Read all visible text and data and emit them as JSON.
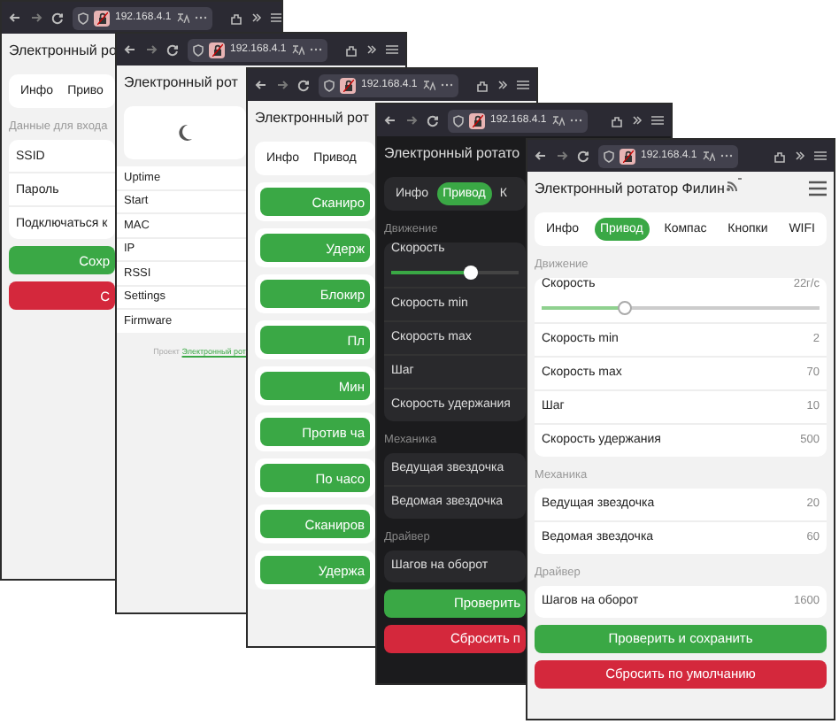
{
  "windows": [
    {
      "dark": false,
      "address": "192.168.4.1",
      "title": "Электронный ро",
      "items": [
        {
          "kind": "tabs",
          "tabs": [
            {
              "label": "Инфо",
              "selected": false
            },
            {
              "label": "Приво",
              "selected": false
            }
          ]
        },
        {
          "kind": "section",
          "text": "Данные для входа"
        },
        {
          "kind": "card",
          "rows": [
            {
              "label": "SSID"
            },
            {
              "label": "Пароль"
            },
            {
              "label": "Подключаться к"
            }
          ]
        },
        {
          "kind": "save_button",
          "label": "Сохр"
        },
        {
          "kind": "reset_button",
          "label": "С"
        }
      ]
    },
    {
      "dark": false,
      "address": "192.168.4.1",
      "title": "Электронный рот",
      "items": [
        {
          "kind": "theme_toggle",
          "on": false
        },
        {
          "kind": "list",
          "rows": [
            "Uptime",
            "Start",
            "MAC",
            "IP",
            "RSSI",
            "Settings",
            "Firmware"
          ]
        },
        {
          "kind": "footer",
          "text": "Проект",
          "link": "Электронный рот"
        }
      ]
    },
    {
      "dark": false,
      "address": "192.168.4.1",
      "title": "Электронный рот",
      "items": [
        {
          "kind": "tabs",
          "tabs": [
            {
              "label": "Инфо",
              "selected": false
            },
            {
              "label": "Привод",
              "selected": false
            }
          ]
        },
        {
          "kind": "card_button",
          "label": "Сканиро"
        },
        {
          "kind": "card_button",
          "label": "Удерж"
        },
        {
          "kind": "card_button",
          "label": "Блокир"
        },
        {
          "kind": "card_button",
          "label": "Пл"
        },
        {
          "kind": "card_button",
          "label": "Мин"
        },
        {
          "kind": "card_button",
          "label": "Против ча"
        },
        {
          "kind": "card_button",
          "label": "По часо"
        },
        {
          "kind": "card_button",
          "label": "Сканиров"
        },
        {
          "kind": "card_button",
          "label": "Удержа"
        }
      ]
    },
    {
      "dark": true,
      "address": "192.168.4.1",
      "title": "Электронный ротато",
      "items": [
        {
          "kind": "tabs",
          "tabs": [
            {
              "label": "Инфо",
              "selected": false
            },
            {
              "label": "Привод",
              "selected": true
            },
            {
              "label": "К",
              "selected": false
            }
          ]
        },
        {
          "kind": "section",
          "text": "Движение"
        },
        {
          "kind": "card",
          "rows": [
            {
              "label": "Скорость",
              "slider": {
                "level": 0.63
              }
            },
            {
              "label": "Скорость min"
            },
            {
              "label": "Скорость max"
            },
            {
              "label": "Шаг"
            },
            {
              "label": "Скорость удержания"
            }
          ]
        },
        {
          "kind": "section",
          "text": "Механика"
        },
        {
          "kind": "card",
          "rows": [
            {
              "label": "Ведущая звездочка"
            },
            {
              "label": "Ведомая звездочка"
            }
          ]
        },
        {
          "kind": "section",
          "text": "Драйвер"
        },
        {
          "kind": "card",
          "rows": [
            {
              "label": "Шагов на оборот"
            }
          ]
        },
        {
          "kind": "save_button",
          "label": "Проверить"
        },
        {
          "kind": "reset_button",
          "label": "Сбросить п"
        }
      ]
    },
    {
      "dark": false,
      "address": "192.168.4.1",
      "title": "Электронный ротатор Филин",
      "items": [
        {
          "kind": "tabs",
          "tabs": [
            {
              "label": "Инфо",
              "selected": false
            },
            {
              "label": "Привод",
              "selected": true
            },
            {
              "label": "Компас",
              "selected": false
            },
            {
              "label": "Кнопки",
              "selected": false
            },
            {
              "label": "WIFI",
              "selected": false
            }
          ]
        },
        {
          "kind": "section",
          "text": "Движение"
        },
        {
          "kind": "card",
          "rows": [
            {
              "label": "Скорость",
              "value": "22г/с",
              "slider": {
                "level": 0.3
              }
            },
            {
              "label": "Скорость min",
              "value": "2"
            },
            {
              "label": "Скорость max",
              "value": "70"
            },
            {
              "label": "Шаг",
              "value": "10"
            },
            {
              "label": "Скорость удержания",
              "value": "500"
            }
          ]
        },
        {
          "kind": "section",
          "text": "Механика"
        },
        {
          "kind": "card",
          "rows": [
            {
              "label": "Ведущая звездочка",
              "value": "20"
            },
            {
              "label": "Ведомая звездочка",
              "value": "60"
            }
          ]
        },
        {
          "kind": "section",
          "text": "Драйвер"
        },
        {
          "kind": "card",
          "rows": [
            {
              "label": "Шагов на оборот",
              "value": "1600"
            }
          ]
        },
        {
          "kind": "save_button",
          "label": "Проверить и сохранить"
        },
        {
          "kind": "reset_button",
          "label": "Сбросить по умолчанию"
        }
      ]
    }
  ]
}
